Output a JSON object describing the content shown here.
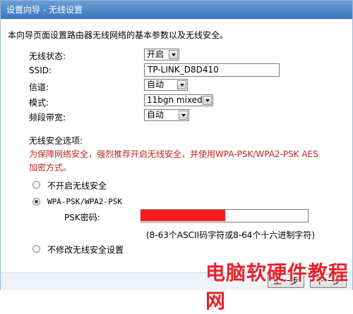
{
  "title": "设置向导 - 无线设置",
  "intro": "本向导页面设置路由器无线网络的基本参数以及无线安全。",
  "fields": {
    "status": {
      "label": "无线状态:",
      "value": "开启"
    },
    "ssid": {
      "label": "SSID:",
      "value": "TP-LINK_D8D410"
    },
    "channel": {
      "label": "信道:",
      "value": "自动"
    },
    "mode": {
      "label": "模式:",
      "value": "11bgn mixed"
    },
    "bandwidth": {
      "label": "频段带宽:",
      "value": "自动"
    }
  },
  "security": {
    "heading": "无线安全选项:",
    "warning": "为保障网络安全，强烈推荐开启无线安全，并使用WPA-PSK/WPA2-PSK AES加密方式。",
    "options": {
      "none": "不开启无线安全",
      "wpa": "WPA-PSK/WPA2-PSK",
      "keep": "不修改无线安全设置"
    },
    "selected": "wpa",
    "psk_label": "PSK密码:",
    "psk_hint": "(8-63个ASCII码字符或8-64个十六进制字符)"
  },
  "buttons": {
    "prev": "上一步",
    "next": "下一步"
  },
  "watermark": "电脑软硬件教程网",
  "colors": {
    "titlebar": "#3b74be",
    "warning": "#c1271f",
    "redaction": "#ff1a1a",
    "watermark": "#e8222d"
  }
}
